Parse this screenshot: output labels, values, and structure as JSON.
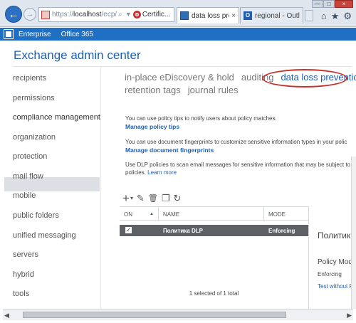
{
  "browser": {
    "url_scheme": "https://",
    "url_host": "localhost",
    "url_path": "/ecp/",
    "cert_label": "Certific...",
    "tabs": [
      {
        "label": "data loss preven...",
        "active": true
      },
      {
        "label": "regional - Outlo...",
        "active": false
      }
    ],
    "close_glyph": "×",
    "min_glyph": "—",
    "max_glyph": "□",
    "win_close_glyph": "×",
    "back_glyph": "←",
    "fwd_glyph": "→",
    "search_glyph": "⌕",
    "search_dropdown_glyph": "▾",
    "cert_glyph": "⊗",
    "home_glyph": "⌂",
    "star_glyph": "★",
    "gear_glyph": "⚙"
  },
  "topbar": {
    "items": [
      "Enterprise",
      "Office 365"
    ]
  },
  "page_title": "Exchange admin center",
  "nav": {
    "items": [
      "recipients",
      "permissions",
      "compliance management",
      "organization",
      "protection",
      "mail flow",
      "mobile",
      "public folders",
      "unified messaging",
      "servers",
      "hybrid",
      "tools"
    ],
    "selected": "compliance management"
  },
  "subnav": {
    "row1": [
      "in-place eDiscovery & hold",
      "auditing",
      "data loss prevention"
    ],
    "row2": [
      "retention tags",
      "journal rules"
    ],
    "current": "data loss prevention"
  },
  "descriptions": {
    "policy_tips_text": "You can use policy tips to notify users about policy matches.",
    "policy_tips_link": "Manage policy tips",
    "fingerprints_text": "You can use document fingerprints to customize sensitive information types in your polic",
    "fingerprints_link": "Manage document fingerprints",
    "dlp_text_1": "Use DLP policies to scan email messages for sensitive information that may be subject to",
    "dlp_text_2": "policies.",
    "learn_more": "Learn more"
  },
  "toolbar": {
    "add_glyph": "+",
    "add_dropdown_glyph": "▾",
    "edit_glyph": "✎",
    "delete_glyph": "🗑",
    "copy_glyph": "❐",
    "refresh_glyph": "↻"
  },
  "grid": {
    "columns": [
      "ON",
      "NAME",
      "MODE"
    ],
    "sort_glyph": "▲",
    "rows": [
      {
        "on": true,
        "check_glyph": "✓",
        "name": "Политика DLP",
        "mode": "Enforcing"
      }
    ],
    "status": "1 selected of 1 total"
  },
  "details": {
    "title": "Политика DLP",
    "mode_label": "Policy Mode",
    "mode_value": "Enforcing",
    "link_text": "Test without Policy"
  },
  "scrollbar": {
    "left_glyph": "◀",
    "right_glyph": "▶"
  }
}
